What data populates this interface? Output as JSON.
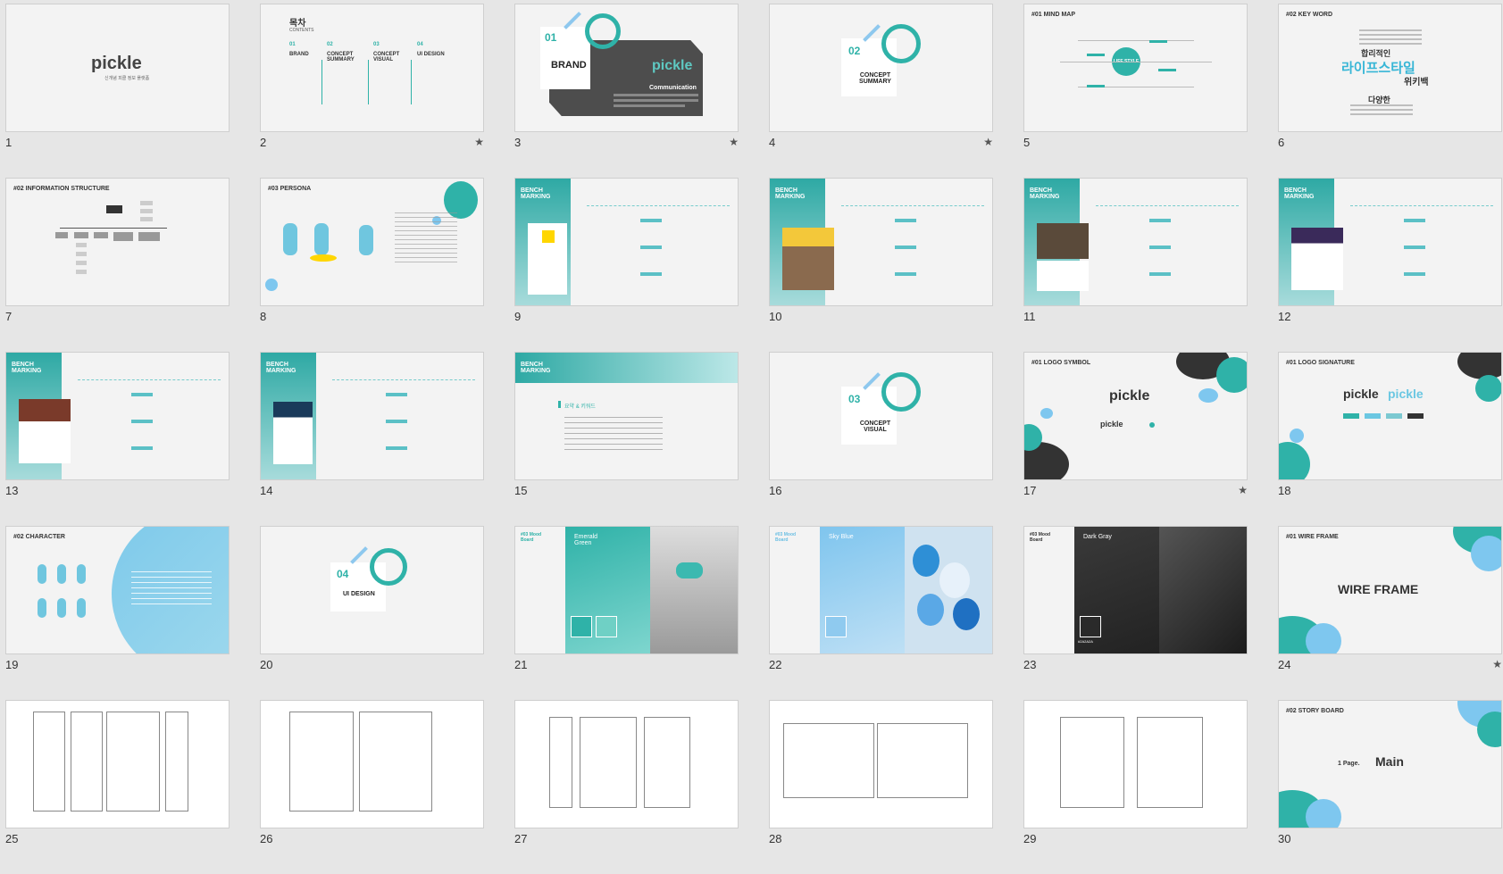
{
  "slides": [
    {
      "n": "1",
      "title": "pickle",
      "subtitle": "신개념 피클 정보 플랫폼",
      "star": ""
    },
    {
      "n": "2",
      "title": "목차",
      "subtitle": "CONTENTS",
      "star": "★",
      "sections": [
        {
          "num": "01",
          "name": "BRAND"
        },
        {
          "num": "02",
          "name": "CONCEPT SUMMARY"
        },
        {
          "num": "03",
          "name": "CONCEPT VISUAL"
        },
        {
          "num": "04",
          "name": "UI DESIGN"
        }
      ]
    },
    {
      "n": "3",
      "num": "01",
      "label": "BRAND",
      "logo": "pickle",
      "heading": "Communication",
      "star": "★"
    },
    {
      "n": "4",
      "num": "02",
      "label": "CONCEPT SUMMARY",
      "star": "★"
    },
    {
      "n": "5",
      "title": "#01 MIND MAP",
      "center": "LIFE STYLE",
      "star": ""
    },
    {
      "n": "6",
      "title": "#02 KEY WORD",
      "words": [
        "라이프스타일",
        "합리적인",
        "위키백",
        "다양한"
      ],
      "star": ""
    },
    {
      "n": "7",
      "title": "#02 INFORMATION STRUCTURE",
      "star": ""
    },
    {
      "n": "8",
      "title": "#03 PERSONA",
      "star": ""
    },
    {
      "n": "9",
      "title": "BENCH MARKING",
      "star": ""
    },
    {
      "n": "10",
      "title": "BENCH MARKING",
      "star": ""
    },
    {
      "n": "11",
      "title": "BENCH MARKING",
      "star": ""
    },
    {
      "n": "12",
      "title": "BENCH MARKING",
      "star": ""
    },
    {
      "n": "13",
      "title": "BENCH MARKING",
      "star": ""
    },
    {
      "n": "14",
      "title": "BENCH MARKING",
      "star": ""
    },
    {
      "n": "15",
      "title": "BENCH MARKING",
      "subtitle": "요약 & 키워드",
      "star": ""
    },
    {
      "n": "16",
      "num": "03",
      "label": "CONCEPT VISUAL",
      "star": ""
    },
    {
      "n": "17",
      "title": "#01 LOGO SYMBOL",
      "logo": "pickle",
      "star": "★"
    },
    {
      "n": "18",
      "title": "#01 LOGO SIGNATURE",
      "logo": "pickle",
      "star": ""
    },
    {
      "n": "19",
      "title": "#02 CHARACTER",
      "star": ""
    },
    {
      "n": "20",
      "num": "04",
      "label": "UI DESIGN",
      "star": ""
    },
    {
      "n": "21",
      "title": "#03 Mood Board",
      "color": "Emerald Green",
      "star": ""
    },
    {
      "n": "22",
      "title": "#03 Mood Board",
      "color": "Sky Blue",
      "star": ""
    },
    {
      "n": "23",
      "title": "#03 Mood Board",
      "color": "Dark Gray",
      "hex": "#2A2A2A",
      "star": ""
    },
    {
      "n": "24",
      "title": "#01 WIRE FRAME",
      "heading": "WIRE FRAME",
      "star": "★"
    },
    {
      "n": "25",
      "star": ""
    },
    {
      "n": "26",
      "star": ""
    },
    {
      "n": "27",
      "star": ""
    },
    {
      "n": "28",
      "star": ""
    },
    {
      "n": "29",
      "star": ""
    },
    {
      "n": "30",
      "title": "#02 STORY BOARD",
      "page": "1 Page.",
      "heading": "Main",
      "star": ""
    }
  ]
}
